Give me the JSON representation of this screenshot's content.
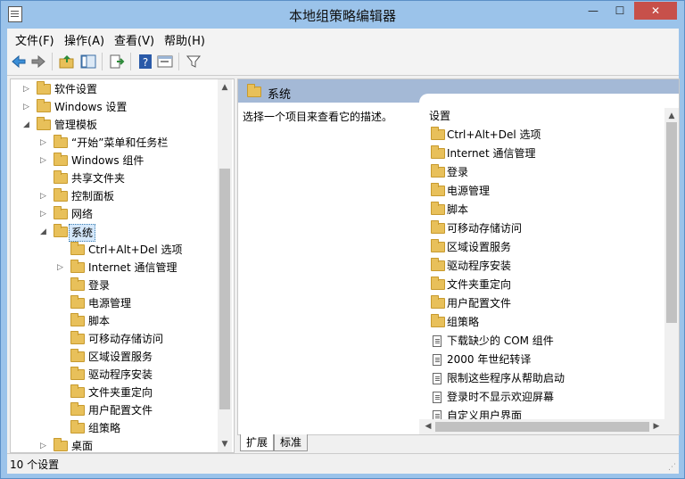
{
  "window": {
    "title": "本地组策略编辑器",
    "min_glyph": "—",
    "max_glyph": "☐",
    "close_glyph": "✕"
  },
  "menu": [
    "文件(F)",
    "操作(A)",
    "查看(V)",
    "帮助(H)"
  ],
  "toolbar": {
    "icons": [
      "back-arrow-icon",
      "forward-arrow-icon",
      "up-folder-icon",
      "show-tree-icon",
      "export-list-icon",
      "help-icon",
      "properties-icon",
      "filter-icon"
    ]
  },
  "tree": [
    {
      "label": "软件设置",
      "arrow": "▷"
    },
    {
      "label": "Windows 设置",
      "arrow": "▷"
    },
    {
      "label": "管理模板",
      "arrow": "◢"
    },
    {
      "label": "“开始”菜单和任务栏",
      "arrow": "▷"
    },
    {
      "label": "Windows 组件",
      "arrow": "▷"
    },
    {
      "label": "共享文件夹",
      "arrow": ""
    },
    {
      "label": "控制面板",
      "arrow": "▷"
    },
    {
      "label": "网络",
      "arrow": "▷"
    },
    {
      "label": "系统",
      "arrow": "◢"
    },
    {
      "label": "Ctrl+Alt+Del 选项",
      "arrow": ""
    },
    {
      "label": "Internet 通信管理",
      "arrow": "▷"
    },
    {
      "label": "登录",
      "arrow": ""
    },
    {
      "label": "电源管理",
      "arrow": ""
    },
    {
      "label": "脚本",
      "arrow": ""
    },
    {
      "label": "可移动存储访问",
      "arrow": ""
    },
    {
      "label": "区域设置服务",
      "arrow": ""
    },
    {
      "label": "驱动程序安装",
      "arrow": ""
    },
    {
      "label": "文件夹重定向",
      "arrow": ""
    },
    {
      "label": "用户配置文件",
      "arrow": ""
    },
    {
      "label": "组策略",
      "arrow": ""
    },
    {
      "label": "桌面",
      "arrow": "▷"
    }
  ],
  "right": {
    "header_title": "系统",
    "description": "选择一个项目来查看它的描述。",
    "column_header": "设置",
    "folders": [
      "Ctrl+Alt+Del 选项",
      "Internet 通信管理",
      "登录",
      "电源管理",
      "脚本",
      "可移动存储访问",
      "区域设置服务",
      "驱动程序安装",
      "文件夹重定向",
      "用户配置文件",
      "组策略"
    ],
    "policies": [
      "下载缺少的 COM 组件",
      "2000 年世纪转译",
      "限制这些程序从帮助启动",
      "登录时不显示欢迎屏幕",
      "自定义用户界面"
    ]
  },
  "tabs": [
    "扩展",
    "标准"
  ],
  "status": {
    "text": "10 个设置"
  },
  "scroll_glyphs": {
    "up": "▲",
    "down": "▼",
    "left": "◀",
    "right": "▶"
  }
}
